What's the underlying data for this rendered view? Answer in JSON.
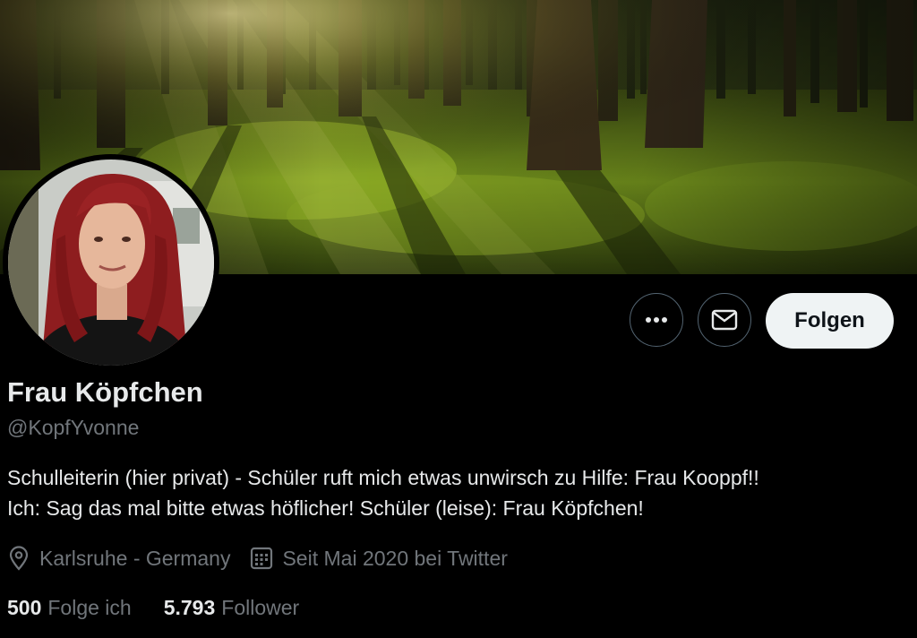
{
  "profile": {
    "name": "Frau Köpfchen",
    "handle": "@KopfYvonne",
    "bio_lines": [
      "Schulleiterin (hier privat) - Schüler ruft mich etwas unwirsch zu Hilfe: Frau Kooppf!!",
      "Ich: Sag das mal bitte etwas höflicher! Schüler (leise): Frau Köpfchen!"
    ],
    "location": "Karlsruhe - Germany",
    "joined": "Seit Mai 2020 bei Twitter"
  },
  "actions": {
    "more_icon": "more-icon",
    "message_icon": "mail-icon",
    "follow_label": "Folgen"
  },
  "stats": {
    "following_count": "500",
    "following_label": "Folge ich",
    "followers_count": "5.793",
    "followers_label": "Follower"
  },
  "colors": {
    "background": "#000000",
    "primary_text": "#e7e9ea",
    "secondary_text": "#71767b",
    "button_border": "#536471",
    "follow_button_bg": "#eff3f4"
  }
}
